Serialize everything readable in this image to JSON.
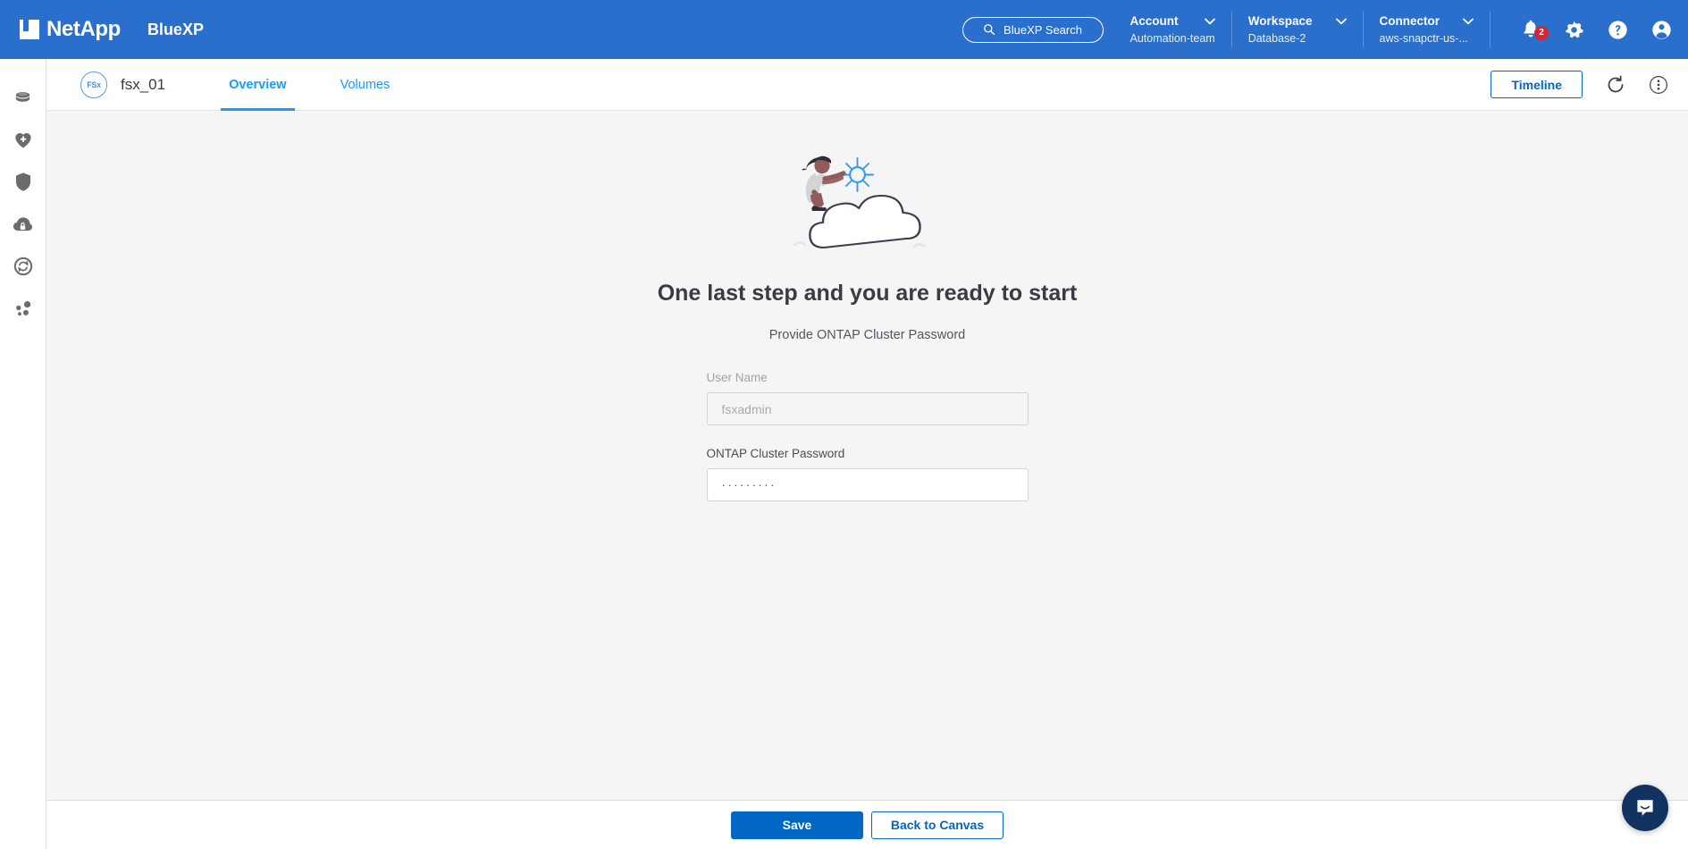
{
  "header": {
    "brand_netapp": "NetApp",
    "brand_product": "BlueXP",
    "search_label": "BlueXP Search",
    "selectors": [
      {
        "label": "Account",
        "value": "Automation-team"
      },
      {
        "label": "Workspace",
        "value": "Database-2"
      },
      {
        "label": "Connector",
        "value": "aws-snapctr-us-..."
      }
    ],
    "icons": {
      "notifications": "bell-icon",
      "notification_count": "2",
      "settings": "gear-icon",
      "help": "help-icon",
      "account": "user-avatar-icon"
    },
    "accent_blue": "#2a6fcb"
  },
  "sidebar": {
    "items": [
      {
        "name": "canvas",
        "icon": "storage-stack-icon"
      },
      {
        "name": "health",
        "icon": "heart-plus-icon"
      },
      {
        "name": "protection",
        "icon": "shield-icon"
      },
      {
        "name": "governance",
        "icon": "cloud-lock-icon"
      },
      {
        "name": "mobility",
        "icon": "sync-circle-icon"
      },
      {
        "name": "extensions",
        "icon": "nodes-icon"
      }
    ]
  },
  "subheader": {
    "env_badge": "FSx",
    "env_name": "fsx_01",
    "tabs": [
      {
        "label": "Overview",
        "active": true
      },
      {
        "label": "Volumes",
        "active": false
      }
    ],
    "timeline_label": "Timeline",
    "refresh_icon": "refresh-icon",
    "more_icon": "more-vertical-icon",
    "link_blue": "#0067c5"
  },
  "main": {
    "illustration": "person-on-cloud-illustration",
    "heading": "One last step and you are ready to start",
    "subheading": "Provide ONTAP Cluster Password",
    "fields": {
      "username": {
        "label": "User Name",
        "value": "fsxadmin",
        "placeholder": "fsxadmin",
        "disabled": true
      },
      "password": {
        "label": "ONTAP Cluster Password",
        "value": "·········",
        "placeholder": "",
        "masked_length": 9
      }
    },
    "background": "#f5f5f5"
  },
  "footer": {
    "save_label": "Save",
    "back_label": "Back to Canvas",
    "primary_color": "#0067c5"
  },
  "chat": {
    "icon": "chat-bubble-icon",
    "color": "#123262"
  }
}
